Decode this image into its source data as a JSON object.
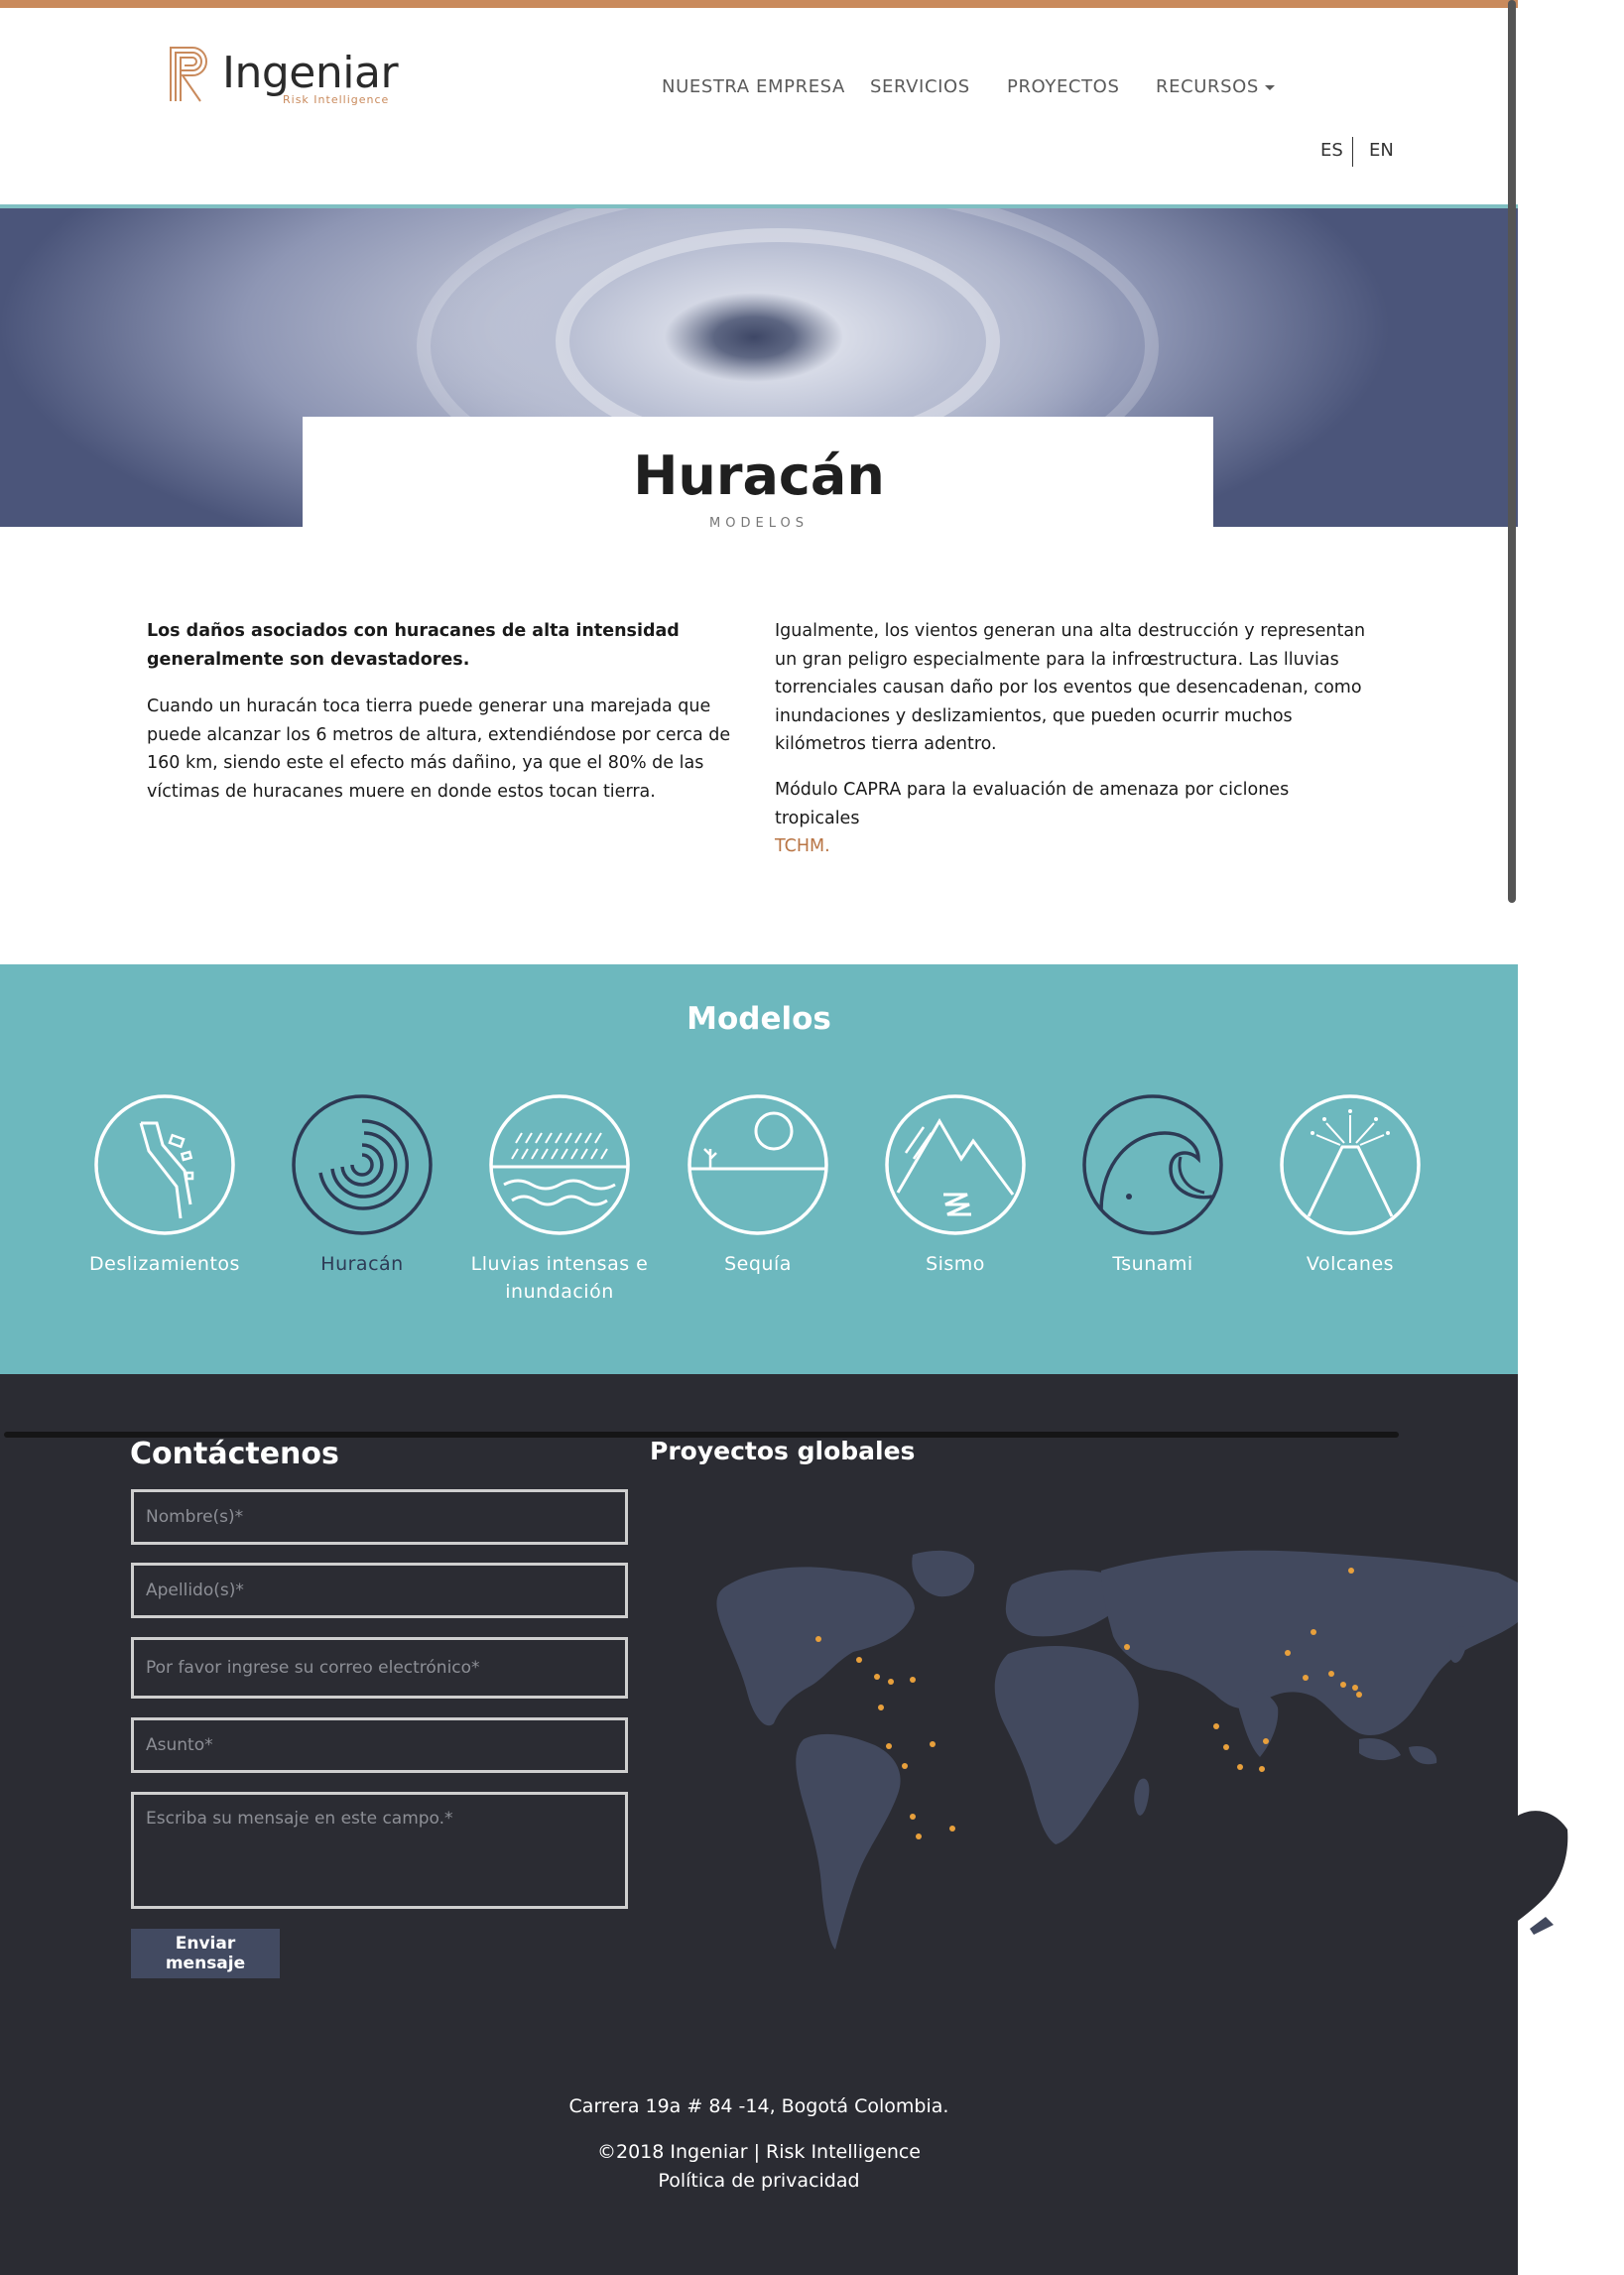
{
  "colors": {
    "accent": "#c98a5c",
    "teal": "#6db8be",
    "dark": "#2b2c33",
    "navy": "#2d3a55"
  },
  "logo": {
    "name": "Ingeniar",
    "tagline": "Risk Intelligence"
  },
  "nav": {
    "items": [
      "NUESTRA EMPRESA",
      "SERVICIOS",
      "PROYECTOS",
      "RECURSOS"
    ],
    "languages": [
      "ES",
      "EN"
    ]
  },
  "hero": {
    "title": "Huracán",
    "subtitle": "MODELOS"
  },
  "intro": {
    "lead": "Los daños asociados con huracanes de alta intensidad generalmente son devastadores.",
    "p1": "Cuando un huracán toca tierra puede generar una marejada que puede alcanzar los 6 metros de altura, extendiéndose por cerca de 160 km, siendo este el efecto más dañino, ya que el 80% de las víctimas de huracanes muere en donde estos tocan tierra.",
    "p2": "Igualmente, los vientos generan una alta destrucción y representan un gran peligro especialmente para la infrœstructura. Las lluvias torrenciales causan daño por los eventos que desencadenan, como inundaciones y deslizamientos, que pueden ocurrir muchos kilómetros tierra adentro.",
    "p3": "Módulo CAPRA para la evaluación de amenaza por ciclones tropicales",
    "p3_link": "TCHM."
  },
  "models": {
    "title": "Modelos",
    "items": [
      {
        "label": "Deslizamientos",
        "icon": "landslide-icon"
      },
      {
        "label": "Huracán",
        "icon": "hurricane-icon",
        "active": true
      },
      {
        "label": "Lluvias intensas e inundación",
        "icon": "rain-flood-icon"
      },
      {
        "label": "Sequía",
        "icon": "drought-icon"
      },
      {
        "label": "Sismo",
        "icon": "earthquake-icon"
      },
      {
        "label": "Tsunami",
        "icon": "tsunami-icon"
      },
      {
        "label": "Volcanes",
        "icon": "volcano-icon"
      }
    ]
  },
  "contact": {
    "title": "Contáctenos",
    "fields": {
      "nombre": "Nombre(s)*",
      "apellido": "Apellido(s)*",
      "correo": "Por favor ingrese su correo electrónico*",
      "asunto": "Asunto*",
      "mensaje": "Escriba su mensaje en este campo.*"
    },
    "submit": "Enviar mensaje"
  },
  "projects": {
    "title": "Proyectos globales"
  },
  "footer": {
    "address": "Carrera 19a # 84 -14, Bogotá Colombia.",
    "copyright": "©2018 Ingeniar | Risk Intelligence",
    "privacy": "Política de privacidad"
  }
}
